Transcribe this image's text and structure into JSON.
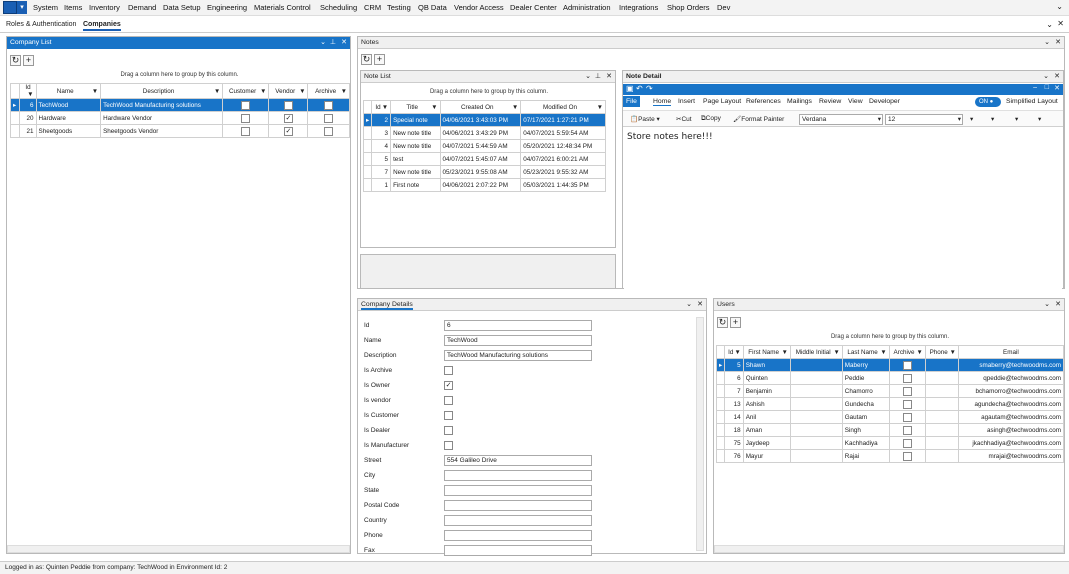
{
  "app": {
    "menu": [
      "System",
      "Items",
      "Inventory",
      "Demand",
      "Data Setup",
      "Engineering",
      "Materials Control",
      "Scheduling",
      "CRM",
      "Testing",
      "QB Data",
      "Vendor Access",
      "Dealer Center",
      "Administration",
      "Integrations",
      "Shop Orders",
      "Dev"
    ]
  },
  "tabs": [
    "Roles & Authentication",
    "Companies"
  ],
  "company_list": {
    "title": "Company List",
    "group_hint": "Drag a column here to group by this column.",
    "columns": [
      "Id",
      "Name",
      "Description",
      "Customer",
      "Vendor",
      "Archive"
    ],
    "rows": [
      {
        "id": "6",
        "name": "TechWood",
        "description": "TechWood Manufacturing solutions",
        "customer": false,
        "vendor": false,
        "archive": false
      },
      {
        "id": "20",
        "name": "Hardware",
        "description": "Hardware Vendor",
        "customer": false,
        "vendor": true,
        "archive": false
      },
      {
        "id": "21",
        "name": "Sheetgoods",
        "description": "Sheetgoods Vendor",
        "customer": false,
        "vendor": true,
        "archive": false
      }
    ]
  },
  "notes": {
    "title": "Notes"
  },
  "note_list": {
    "title": "Note List",
    "group_hint": "Drag a column here to group by this column.",
    "columns": [
      "Id",
      "Title",
      "Created On",
      "Modified On"
    ],
    "rows": [
      {
        "id": "2",
        "title": "Special note",
        "created": "04/06/2021 3:43:03 PM",
        "modified": "07/17/2021 1:27:21 PM"
      },
      {
        "id": "3",
        "title": "New note title",
        "created": "04/06/2021 3:43:29 PM",
        "modified": "04/07/2021 5:59:54 AM"
      },
      {
        "id": "4",
        "title": "New note title",
        "created": "04/07/2021 5:44:59 AM",
        "modified": "05/20/2021 12:48:34 PM"
      },
      {
        "id": "5",
        "title": "test",
        "created": "04/07/2021 5:45:07 AM",
        "modified": "04/07/2021 6:00:21 AM"
      },
      {
        "id": "7",
        "title": "New note title",
        "created": "05/23/2021 9:55:08 AM",
        "modified": "05/23/2021 9:55:32 AM"
      },
      {
        "id": "1",
        "title": "First note",
        "created": "04/06/2021 2:07:22 PM",
        "modified": "05/03/2021 1:44:35 PM"
      }
    ]
  },
  "note_detail": {
    "title": "Note Detail",
    "ribbon_tabs": [
      "File",
      "Home",
      "Insert",
      "Page Layout",
      "References",
      "Mailings",
      "Review",
      "View",
      "Developer"
    ],
    "toggle_on": "ON",
    "simplified_layout": "Simplified Layout",
    "paste": "Paste",
    "cut": "Cut",
    "copy": "Copy",
    "format_painter": "Format Painter",
    "font": "Verdana",
    "font_size": "12",
    "content": "Store notes here!!!"
  },
  "company_details": {
    "title": "Company Details",
    "fields": [
      {
        "label": "Id",
        "value": "6",
        "type": "text"
      },
      {
        "label": "Name",
        "value": "TechWood",
        "type": "text"
      },
      {
        "label": "Description",
        "value": "TechWood Manufacturing solutions",
        "type": "text"
      },
      {
        "label": "Is Archive",
        "checked": false,
        "type": "check"
      },
      {
        "label": "Is Owner",
        "checked": true,
        "type": "check"
      },
      {
        "label": "Is vendor",
        "checked": false,
        "type": "check"
      },
      {
        "label": "Is Customer",
        "checked": false,
        "type": "check"
      },
      {
        "label": "Is Dealer",
        "checked": false,
        "type": "check"
      },
      {
        "label": "Is Manufacturer",
        "checked": false,
        "type": "check"
      },
      {
        "label": "Street",
        "value": "554 Galileo Drive",
        "type": "text"
      },
      {
        "label": "City",
        "value": "",
        "type": "text"
      },
      {
        "label": "State",
        "value": "",
        "type": "text"
      },
      {
        "label": "Postal Code",
        "value": "",
        "type": "text"
      },
      {
        "label": "Country",
        "value": "",
        "type": "text"
      },
      {
        "label": "Phone",
        "value": "",
        "type": "text"
      },
      {
        "label": "Fax",
        "value": "",
        "type": "text"
      }
    ]
  },
  "users": {
    "title": "Users",
    "group_hint": "Drag a column here to group by this column.",
    "columns": [
      "Id",
      "First Name",
      "Middle Initial",
      "Last Name",
      "Archive",
      "Phone",
      "Email"
    ],
    "rows": [
      {
        "id": "5",
        "first": "Shawn",
        "middle": "",
        "last": "Maberry",
        "archive": false,
        "phone": "",
        "email": "smaberry@techwoodms.com"
      },
      {
        "id": "6",
        "first": "Quinten",
        "middle": "",
        "last": "Peddie",
        "archive": false,
        "phone": "",
        "email": "qpeddie@techwoodms.com"
      },
      {
        "id": "7",
        "first": "Benjamin",
        "middle": "",
        "last": "Chamorro",
        "archive": false,
        "phone": "",
        "email": "bchamorro@techwoodms.com"
      },
      {
        "id": "13",
        "first": "Ashish",
        "middle": "",
        "last": "Gundecha",
        "archive": false,
        "phone": "",
        "email": "agundecha@techwoodms.com"
      },
      {
        "id": "14",
        "first": "Anil",
        "middle": "",
        "last": "Gautam",
        "archive": false,
        "phone": "",
        "email": "agautam@techwoodms.com"
      },
      {
        "id": "18",
        "first": "Aman",
        "middle": "",
        "last": "Singh",
        "archive": false,
        "phone": "",
        "email": "asingh@techwoodms.com"
      },
      {
        "id": "75",
        "first": "Jaydeep",
        "middle": "",
        "last": "Kachhadiya",
        "archive": false,
        "phone": "",
        "email": "jkachhadiya@techwoodms.com"
      },
      {
        "id": "76",
        "first": "Mayur",
        "middle": "",
        "last": "Rajai",
        "archive": false,
        "phone": "",
        "email": "mrajai@techwoodms.com"
      }
    ]
  },
  "status": "Logged in as: Quinten Peddie  from company: TechWood in Environment Id: 2"
}
